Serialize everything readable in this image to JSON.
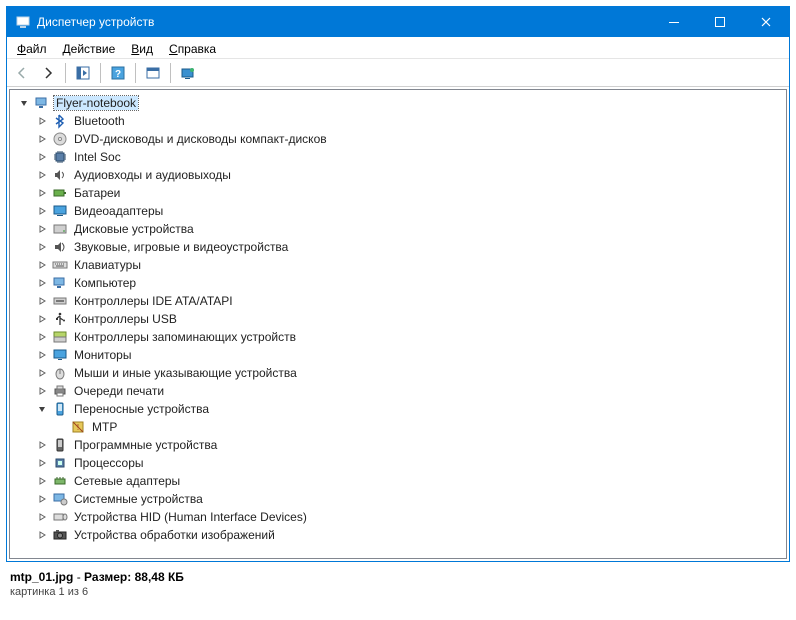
{
  "window": {
    "title": "Диспетчер устройств"
  },
  "menu": {
    "items": [
      {
        "u": "Ф",
        "rest": "айл"
      },
      {
        "u": "Д",
        "rest": "ействие"
      },
      {
        "u": "В",
        "rest": "ид"
      },
      {
        "u": "С",
        "rest": "правка"
      }
    ]
  },
  "tree": {
    "root": "Flyer-notebook",
    "nodes": [
      {
        "icon": "bt",
        "label": "Bluetooth",
        "expandable": true
      },
      {
        "icon": "dvd",
        "label": "DVD-дисководы и дисководы компакт-дисков",
        "expandable": true
      },
      {
        "icon": "chip",
        "label": "Intel Soc",
        "expandable": true
      },
      {
        "icon": "audio",
        "label": "Аудиовходы и аудиовыходы",
        "expandable": true
      },
      {
        "icon": "battery",
        "label": "Батареи",
        "expandable": true
      },
      {
        "icon": "display",
        "label": "Видеоадаптеры",
        "expandable": true
      },
      {
        "icon": "disk",
        "label": "Дисковые устройства",
        "expandable": true
      },
      {
        "icon": "sound",
        "label": "Звуковые, игровые и видеоустройства",
        "expandable": true
      },
      {
        "icon": "keyboard",
        "label": "Клавиатуры",
        "expandable": true
      },
      {
        "icon": "computer",
        "label": "Компьютер",
        "expandable": true
      },
      {
        "icon": "ide",
        "label": "Контроллеры IDE ATA/ATAPI",
        "expandable": true
      },
      {
        "icon": "usb",
        "label": "Контроллеры USB",
        "expandable": true
      },
      {
        "icon": "storage",
        "label": "Контроллеры запоминающих устройств",
        "expandable": true
      },
      {
        "icon": "monitor",
        "label": "Мониторы",
        "expandable": true
      },
      {
        "icon": "mouse",
        "label": "Мыши и иные указывающие устройства",
        "expandable": true
      },
      {
        "icon": "printer",
        "label": "Очереди печати",
        "expandable": true
      },
      {
        "icon": "portable",
        "label": "Переносные устройства",
        "expandable": true,
        "expanded": true,
        "children": [
          {
            "icon": "warn",
            "label": "MTP",
            "expandable": false
          }
        ]
      },
      {
        "icon": "software",
        "label": "Программные устройства",
        "expandable": true
      },
      {
        "icon": "cpu",
        "label": "Процессоры",
        "expandable": true
      },
      {
        "icon": "net",
        "label": "Сетевые адаптеры",
        "expandable": true
      },
      {
        "icon": "system",
        "label": "Системные устройства",
        "expandable": true
      },
      {
        "icon": "hid",
        "label": "Устройства HID (Human Interface Devices)",
        "expandable": true
      },
      {
        "icon": "imaging",
        "label": "Устройства обработки изображений",
        "expandable": true
      }
    ]
  },
  "footer": {
    "filename": "mtp_01.jpg",
    "sep": " - ",
    "size_label": "Размер:",
    "size_value": "88,48 КБ",
    "line2": "картинка 1 из 6"
  }
}
